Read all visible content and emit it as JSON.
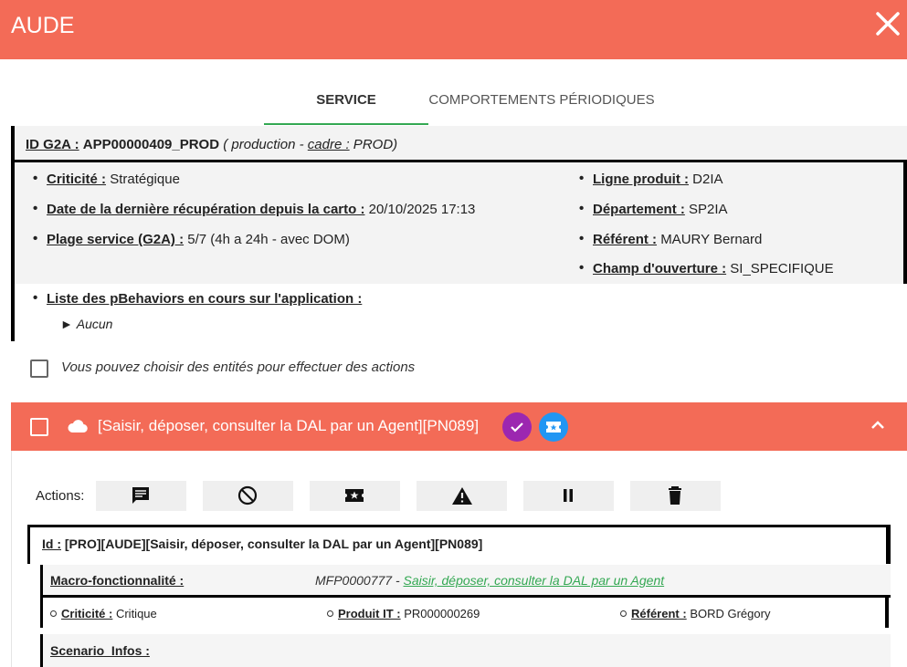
{
  "app": {
    "title": "AUDE"
  },
  "tabs": [
    {
      "label": "SERVICE",
      "active": true
    },
    {
      "label": "COMPORTEMENTS PÉRIODIQUES",
      "active": false
    }
  ],
  "info": {
    "id_label": "ID G2A :",
    "id_value": "APP00000409_PROD",
    "env_prefix": "( production - ",
    "cadre_label": "cadre :",
    "cadre_value": " PROD)",
    "criticite_label": "Criticité :",
    "criticite_value": "Stratégique",
    "date_label": "Date de la dernière récupération depuis la carto :",
    "date_value": "20/10/2025 17:13",
    "plage_label": "Plage service (G2A) :",
    "plage_value": "5/7 (4h a 24h - avec DOM)",
    "ligne_label": "Ligne produit :",
    "ligne_value": "D2IA",
    "dept_label": "Département :",
    "dept_value": "SP2IA",
    "referent_label": "Référent :",
    "referent_value": "MAURY Bernard",
    "champ_label": "Champ d'ouverture :",
    "champ_value": "SI_SPECIFIQUE",
    "pbehaviors_label": "Liste des pBehaviors en cours sur l'application :",
    "pbehaviors_arrow": "►",
    "pbehaviors_value": "Aucun"
  },
  "selection_hint": "Vous pouvez choisir des entités pour effectuer des actions",
  "panel": {
    "title": "[Saisir, déposer, consulter la DAL par un Agent][PN089]",
    "actions_label": "Actions:"
  },
  "entity": {
    "id_label": "Id :",
    "id_value": "[PRO][AUDE][Saisir, déposer, consulter la DAL par un Agent][PN089]",
    "macro_label": "Macro-fonctionnalité :",
    "macro_code": "MFP0000777 - ",
    "macro_link": "Saisir, déposer, consulter la DAL par un Agent",
    "criticite_label": "Criticité :",
    "criticite_value": "Critique",
    "produit_label": "Produit IT :",
    "produit_value": "PR000000269",
    "referent_label": "Référent :",
    "referent_value": "BORD Grégory",
    "scenario_label": "Scenario_Infos :"
  },
  "colors": {
    "header": "#f36b57",
    "tab_indicator": "#34a853",
    "check_badge": "#9c27b0",
    "ticket_badge": "#2196f3",
    "link": "#34a853"
  },
  "icons": [
    "close-icon",
    "cloud-icon",
    "check-icon",
    "ticket-icon",
    "chevron-up-icon",
    "comment-icon",
    "cancel-icon",
    "ticket-icon",
    "warning-icon",
    "pause-icon",
    "delete-icon"
  ]
}
